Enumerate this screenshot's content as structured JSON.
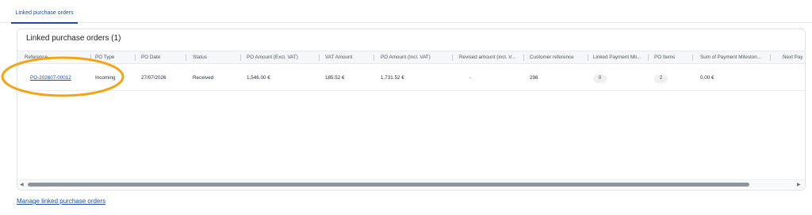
{
  "tabs": [
    {
      "label": "Linked purchase orders"
    }
  ],
  "card": {
    "title": "Linked purchase orders (1)"
  },
  "columns": [
    "Reference",
    "PO Type",
    "PO Date",
    "Status",
    "PO Amount (Excl. VAT)",
    "VAT Amount",
    "PO Amount (Incl. VAT)",
    "Revised amount (incl. V...",
    "Customer reference",
    "Linked Payment Mil...",
    "PO Items",
    "Sum of Payment Mileston...",
    "Next Pay"
  ],
  "rows": [
    {
      "reference": "PO-202607-00012",
      "po_type": "Incoming",
      "po_date": "27/07/2026",
      "status": "Received",
      "amount_excl": "1,546.00 €",
      "vat": "185.52 €",
      "amount_incl": "1,731.52 €",
      "revised": "-",
      "customer_ref": "298",
      "linked_milestones": "0",
      "po_items": "2",
      "sum_milestones": "0.00 €"
    }
  ],
  "footer": {
    "manage_link": "Manage linked purchase orders"
  },
  "colors": {
    "accent": "#1d4f9c",
    "highlight": "#f2a516",
    "scroll_thumb": "#8f959c"
  },
  "icons": {
    "scroll_left": "chevron-left-icon",
    "scroll_right": "chevron-right-icon"
  }
}
